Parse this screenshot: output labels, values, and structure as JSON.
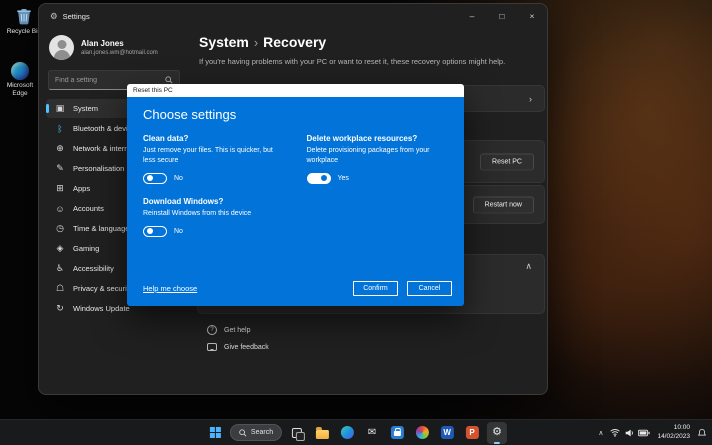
{
  "colors": {
    "accent_blue": "#4cc2ff",
    "dialog_blue": "#0273d8",
    "window_bg": "#202020"
  },
  "icons": {
    "gear": "⚙",
    "chevron_right": "›",
    "chevron_up": "∧",
    "minimize": "–",
    "maximize": "□",
    "close": "×",
    "mail": "✉",
    "question": "?"
  },
  "desktop": {
    "icons": [
      {
        "name": "recycle-bin",
        "label": "Recycle Bin"
      },
      {
        "name": "microsoft-edge",
        "label": "Microsoft Edge"
      }
    ]
  },
  "settings_window": {
    "title": "Settings",
    "profile": {
      "name": "Alan Jones",
      "email": "alan.jones.wm@hotmail.com"
    },
    "search_placeholder": "Find a setting",
    "nav": [
      {
        "label": "System",
        "glyph": "▣",
        "selected": true
      },
      {
        "label": "Bluetooth & devices",
        "glyph": "ᛒ"
      },
      {
        "label": "Network & internet",
        "glyph": "⊕"
      },
      {
        "label": "Personalisation",
        "glyph": "✎"
      },
      {
        "label": "Apps",
        "glyph": "⊞"
      },
      {
        "label": "Accounts",
        "glyph": "☺"
      },
      {
        "label": "Time & language",
        "glyph": "◷"
      },
      {
        "label": "Gaming",
        "glyph": "◈"
      },
      {
        "label": "Accessibility",
        "glyph": "♿"
      },
      {
        "label": "Privacy & security",
        "glyph": "☖"
      },
      {
        "label": "Windows Update",
        "glyph": "↻"
      }
    ],
    "page": {
      "breadcrumb_root": "System",
      "breadcrumb_separator": "›",
      "title": "Recovery",
      "description": "If you're having problems with your PC or want to reset it, these recovery options might help.",
      "reset_pc_button": "Reset PC",
      "restart_now_button": "Restart now",
      "get_help": "Get help",
      "give_feedback": "Give feedback"
    }
  },
  "dialog": {
    "window_title": "Reset this PC",
    "heading": "Choose settings",
    "options": [
      {
        "title": "Clean data?",
        "description": "Just remove your files. This is quicker, but less secure",
        "value": "No",
        "on": false
      },
      {
        "title": "Delete workplace resources?",
        "description": "Delete provisioning packages from your workplace",
        "value": "Yes",
        "on": true
      },
      {
        "title": "Download Windows?",
        "description": "Reinstall Windows from this device",
        "value": "No",
        "on": false
      }
    ],
    "help_link": "Help me choose",
    "confirm_button": "Confirm",
    "cancel_button": "Cancel"
  },
  "taskbar": {
    "search_label": "Search",
    "word_label": "W",
    "powerpoint_label": "P",
    "clock": {
      "time": "10:00",
      "date": "14/02/2023"
    }
  }
}
